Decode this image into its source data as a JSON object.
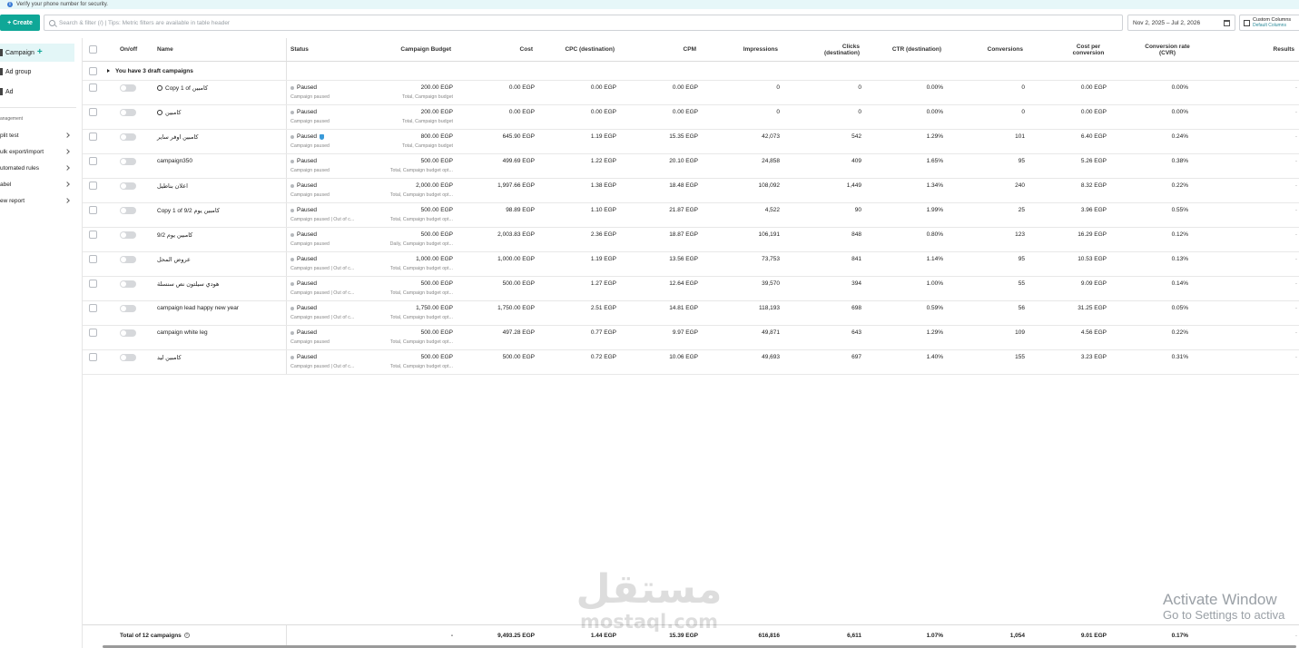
{
  "banner": {
    "text": "Verify your phone number for security."
  },
  "toolbar": {
    "create_label": "+ Create",
    "search_placeholder": "Search & filter (/) | Tips: Metric filters are available in table header",
    "date_range": "Nov 2, 2025 – Jul 2, 2026",
    "columns_title": "Custom Columns",
    "columns_sub": "Default Columns"
  },
  "sidebar": {
    "levels": [
      "Campaign",
      "Ad group",
      "Ad"
    ],
    "section_title": "anagement",
    "links": [
      "plit test",
      "ulk export/import",
      "utomated rules",
      "abel",
      "ew report"
    ]
  },
  "table": {
    "headers": {
      "onoff": "On/off",
      "name": "Name",
      "status": "Status",
      "budget": "Campaign Budget",
      "cost": "Cost",
      "cpc": "CPC (destination)",
      "cpm": "CPM",
      "impressions": "Impressions",
      "clicks1": "Clicks",
      "clicks2": "(destination)",
      "ctr": "CTR (destination)",
      "conversions": "Conversions",
      "cpconv1": "Cost per",
      "cpconv2": "conversion",
      "cvr1": "Conversion rate",
      "cvr2": "(CVR)",
      "results": "Results"
    },
    "draft_text": "You have 3 draft campaigns",
    "rows": [
      {
        "name": "Copy 1 of كامبين",
        "status": "Paused",
        "status_sub": "Campaign paused",
        "budget": "200.00 EGP",
        "budget_sub": "Total, Campaign budget",
        "cost": "0.00 EGP",
        "cpc": "0.00 EGP",
        "cpm": "0.00 EGP",
        "impressions": "0",
        "clicks": "0",
        "ctr": "0.00%",
        "conversions": "0",
        "cpconv": "0.00 EGP",
        "cvr": "0.00%",
        "results": "-"
      },
      {
        "name": "كامبين",
        "status": "Paused",
        "status_sub": "Campaign paused",
        "budget": "200.00 EGP",
        "budget_sub": "Total, Campaign budget",
        "cost": "0.00 EGP",
        "cpc": "0.00 EGP",
        "cpm": "0.00 EGP",
        "impressions": "0",
        "clicks": "0",
        "ctr": "0.00%",
        "conversions": "0",
        "cpconv": "0.00 EGP",
        "cvr": "0.00%",
        "results": "-"
      },
      {
        "name": "كامبين اوفر ساير",
        "status": "Paused",
        "status_sub": "Campaign paused",
        "budget": "800.00 EGP",
        "budget_sub": "Total, Campaign budget",
        "cost": "645.90 EGP",
        "cpc": "1.19 EGP",
        "cpm": "15.35 EGP",
        "impressions": "42,073",
        "clicks": "542",
        "ctr": "1.29%",
        "conversions": "101",
        "cpconv": "6.40 EGP",
        "cvr": "0.24%",
        "results": "-"
      },
      {
        "name": "campaign350",
        "status": "Paused",
        "status_sub": "Campaign paused",
        "budget": "500.00 EGP",
        "budget_sub": "Total, Campaign budget opt...",
        "cost": "499.69 EGP",
        "cpc": "1.22 EGP",
        "cpm": "20.10 EGP",
        "impressions": "24,858",
        "clicks": "409",
        "ctr": "1.65%",
        "conversions": "95",
        "cpconv": "5.26 EGP",
        "cvr": "0.38%",
        "results": "-"
      },
      {
        "name": "اعلان بناطيل",
        "status": "Paused",
        "status_sub": "Campaign paused",
        "budget": "2,000.00 EGP",
        "budget_sub": "Total, Campaign budget opt...",
        "cost": "1,997.66 EGP",
        "cpc": "1.38 EGP",
        "cpm": "18.48 EGP",
        "impressions": "108,092",
        "clicks": "1,449",
        "ctr": "1.34%",
        "conversions": "240",
        "cpconv": "8.32 EGP",
        "cvr": "0.22%",
        "results": "-"
      },
      {
        "name": "Copy 1 of 9/2 كامبين يوم",
        "status": "Paused",
        "status_sub": "Campaign paused | Out of c...",
        "budget": "500.00 EGP",
        "budget_sub": "Total, Campaign budget opt...",
        "cost": "98.89 EGP",
        "cpc": "1.10 EGP",
        "cpm": "21.87 EGP",
        "impressions": "4,522",
        "clicks": "90",
        "ctr": "1.99%",
        "conversions": "25",
        "cpconv": "3.96 EGP",
        "cvr": "0.55%",
        "results": "-"
      },
      {
        "name": "9/2 كامبين يوم",
        "status": "Paused",
        "status_sub": "Campaign paused",
        "budget": "500.00 EGP",
        "budget_sub": "Daily, Campaign budget opt...",
        "cost": "2,003.83 EGP",
        "cpc": "2.36 EGP",
        "cpm": "18.87 EGP",
        "impressions": "106,191",
        "clicks": "848",
        "ctr": "0.80%",
        "conversions": "123",
        "cpconv": "16.29 EGP",
        "cvr": "0.12%",
        "results": "-"
      },
      {
        "name": "عروض المحل",
        "status": "Paused",
        "status_sub": "Campaign paused | Out of c...",
        "budget": "1,000.00 EGP",
        "budget_sub": "Total, Campaign budget opt...",
        "cost": "1,000.00 EGP",
        "cpc": "1.19 EGP",
        "cpm": "13.56 EGP",
        "impressions": "73,753",
        "clicks": "841",
        "ctr": "1.14%",
        "conversions": "95",
        "cpconv": "10.53 EGP",
        "cvr": "0.13%",
        "results": "-"
      },
      {
        "name": "هودي سيلتون نص سنسلة",
        "status": "Paused",
        "status_sub": "Campaign paused | Out of c...",
        "budget": "500.00 EGP",
        "budget_sub": "Total, Campaign budget opt...",
        "cost": "500.00 EGP",
        "cpc": "1.27 EGP",
        "cpm": "12.64 EGP",
        "impressions": "39,570",
        "clicks": "394",
        "ctr": "1.00%",
        "conversions": "55",
        "cpconv": "9.09 EGP",
        "cvr": "0.14%",
        "results": "-"
      },
      {
        "name": "campaign lead happy new year",
        "status": "Paused",
        "status_sub": "Campaign paused | Out of c...",
        "budget": "1,750.00 EGP",
        "budget_sub": "Total, Campaign budget opt...",
        "cost": "1,750.00 EGP",
        "cpc": "2.51 EGP",
        "cpm": "14.81 EGP",
        "impressions": "118,193",
        "clicks": "698",
        "ctr": "0.59%",
        "conversions": "56",
        "cpconv": "31.25 EGP",
        "cvr": "0.05%",
        "results": "-"
      },
      {
        "name": "campaign white leg",
        "status": "Paused",
        "status_sub": "Campaign paused",
        "budget": "500.00 EGP",
        "budget_sub": "Total, Campaign budget opt...",
        "cost": "497.28 EGP",
        "cpc": "0.77 EGP",
        "cpm": "9.97 EGP",
        "impressions": "49,871",
        "clicks": "643",
        "ctr": "1.29%",
        "conversions": "109",
        "cpconv": "4.56 EGP",
        "cvr": "0.22%",
        "results": "-"
      },
      {
        "name": "كامبين ليد",
        "status": "Paused",
        "status_sub": "Campaign paused | Out of c...",
        "budget": "500.00 EGP",
        "budget_sub": "Total, Campaign budget opt...",
        "cost": "500.00 EGP",
        "cpc": "0.72 EGP",
        "cpm": "10.06 EGP",
        "impressions": "49,693",
        "clicks": "697",
        "ctr": "1.40%",
        "conversions": "155",
        "cpconv": "3.23 EGP",
        "cvr": "0.31%",
        "results": "-"
      }
    ],
    "total": {
      "label": "Total of 12 campaigns",
      "budget": "-",
      "cost": "9,493.25 EGP",
      "cpc": "1.44 EGP",
      "cpm": "15.39 EGP",
      "impressions": "616,816",
      "clicks": "6,611",
      "ctr": "1.07%",
      "conversions": "1,054",
      "cpconv": "9.01 EGP",
      "cvr": "0.17%",
      "results": "-"
    }
  },
  "overlay": {
    "activate_title": "Activate Window",
    "activate_sub": "Go to Settings to activa",
    "watermark_arabic": "مستقل",
    "watermark_latin": "mostaql.com"
  },
  "colors": {
    "accent": "#0fa797",
    "active_bg": "#e3f6f7",
    "banner_bg": "#e6f7f9"
  }
}
